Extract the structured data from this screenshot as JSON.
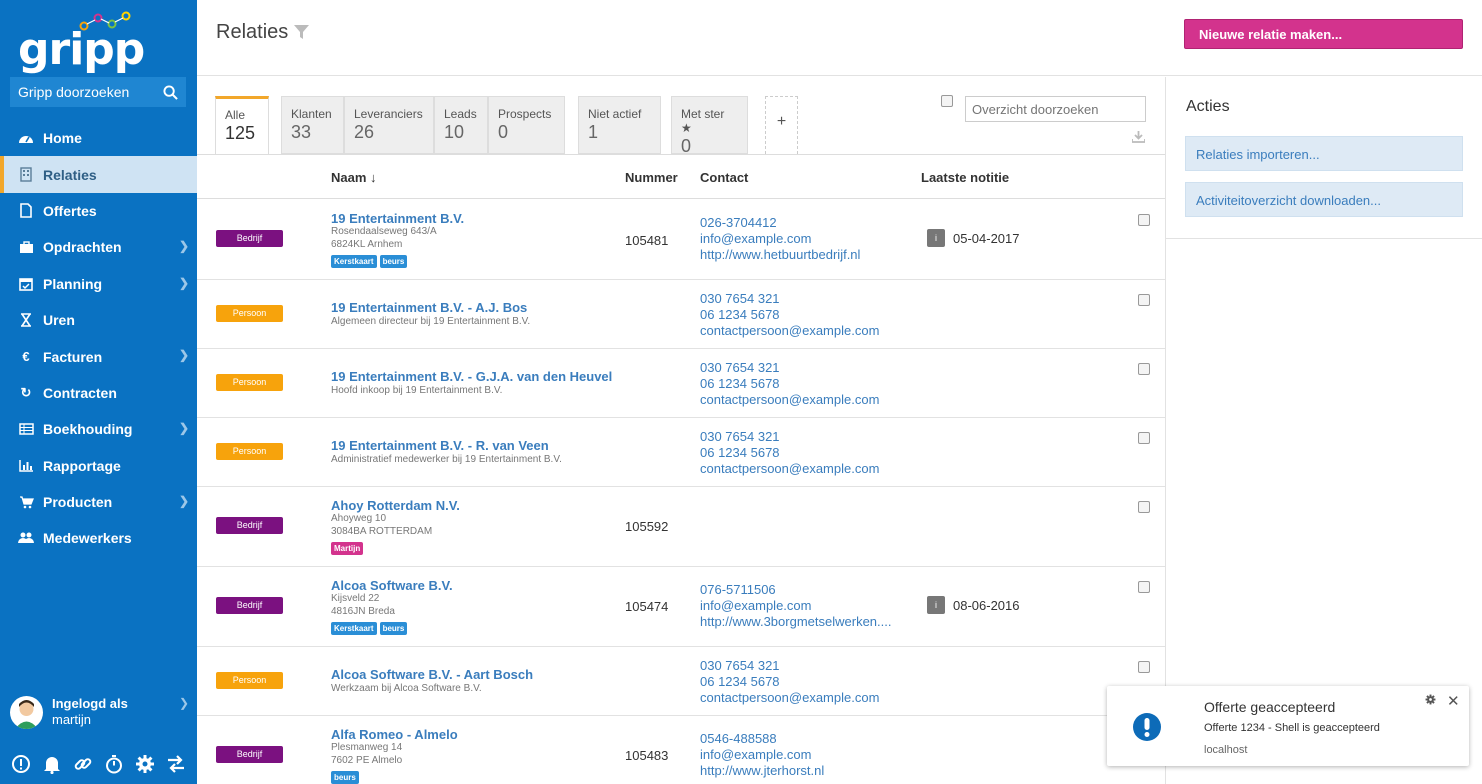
{
  "brand": {
    "logo_text": "gripp",
    "accent": "#0a72c2",
    "active_bar": "#f2a72a"
  },
  "sidebar": {
    "search_label": "Gripp doorzoeken",
    "items": [
      {
        "label": "Home",
        "icon": "dashboard-icon"
      },
      {
        "label": "Relaties",
        "icon": "building-icon"
      },
      {
        "label": "Offertes",
        "icon": "document-icon"
      },
      {
        "label": "Opdrachten",
        "icon": "briefcase-icon"
      },
      {
        "label": "Planning",
        "icon": "calendar-icon"
      },
      {
        "label": "Uren",
        "icon": "hourglass-icon"
      },
      {
        "label": "Facturen",
        "icon": "euro-icon"
      },
      {
        "label": "Contracten",
        "icon": "refresh-icon"
      },
      {
        "label": "Boekhouding",
        "icon": "ledger-icon"
      },
      {
        "label": "Rapportage",
        "icon": "bar-chart-icon"
      },
      {
        "label": "Producten",
        "icon": "cart-icon"
      },
      {
        "label": "Medewerkers",
        "icon": "users-icon"
      }
    ],
    "user": {
      "logged_in_label": "Ingelogd als",
      "name": "martijn"
    }
  },
  "header": {
    "title": "Relaties",
    "new_button": "Nieuwe relatie maken..."
  },
  "tabs": [
    {
      "label": "Alle",
      "count": "125"
    },
    {
      "label": "Klanten",
      "count": "33"
    },
    {
      "label": "Leveranciers",
      "count": "26"
    },
    {
      "label": "Leads",
      "count": "10"
    },
    {
      "label": "Prospects",
      "count": "0"
    },
    {
      "label": "Niet actief",
      "count": "1"
    },
    {
      "label": "Met ster ★",
      "count": "0"
    },
    {
      "label": "+"
    }
  ],
  "overview_search_placeholder": "Overzicht doorzoeken",
  "table": {
    "headers": {
      "name": "Naam ↓",
      "number": "Nummer",
      "contact": "Contact",
      "last_note": "Laatste notitie"
    },
    "rows": [
      {
        "type": "Bedrijf",
        "name": "19 Entertainment B.V.",
        "sub": [
          "Rosendaalseweg 643/A",
          "6824KL Arnhem"
        ],
        "tags": [
          "Kerstkaart",
          "beurs"
        ],
        "number": "105481",
        "contact": [
          "026-3704412",
          "info@example.com",
          "http://www.hetbuurtbedrijf.nl"
        ],
        "note": {
          "icon": "i",
          "date": "05-04-2017"
        }
      },
      {
        "type": "Persoon",
        "name": "19 Entertainment B.V. - A.J. Bos",
        "sub": [
          "Algemeen directeur bij 19 Entertainment B.V."
        ],
        "tags": [],
        "number": "",
        "contact": [
          "030 7654 321",
          "06 1234 5678",
          "contactpersoon@example.com"
        ]
      },
      {
        "type": "Persoon",
        "name": "19 Entertainment B.V. - G.J.A. van den Heuvel",
        "sub": [
          "Hoofd inkoop bij 19 Entertainment B.V."
        ],
        "tags": [],
        "number": "",
        "contact": [
          "030 7654 321",
          "06 1234 5678",
          "contactpersoon@example.com"
        ]
      },
      {
        "type": "Persoon",
        "name": "19 Entertainment B.V. - R. van Veen",
        "sub": [
          "Administratief medewerker bij 19 Entertainment B.V."
        ],
        "tags": [],
        "number": "",
        "contact": [
          "030 7654 321",
          "06 1234 5678",
          "contactpersoon@example.com"
        ]
      },
      {
        "type": "Bedrijf",
        "name": "Ahoy Rotterdam N.V.",
        "sub": [
          "Ahoyweg 10",
          "3084BA ROTTERDAM"
        ],
        "tags": [
          "Martijn"
        ],
        "number": "105592",
        "contact": []
      },
      {
        "type": "Bedrijf",
        "name": "Alcoa Software B.V.",
        "sub": [
          "Kijsveld 22",
          "4816JN Breda"
        ],
        "tags": [
          "Kerstkaart",
          "beurs"
        ],
        "number": "105474",
        "contact": [
          "076-5711506",
          "info@example.com",
          "http://www.3borgmetselwerken...."
        ],
        "note": {
          "icon": "i",
          "date": "08-06-2016"
        }
      },
      {
        "type": "Persoon",
        "name": "Alcoa Software B.V. - Aart Bosch",
        "sub": [
          "Werkzaam bij Alcoa Software B.V."
        ],
        "tags": [],
        "number": "",
        "contact": [
          "030 7654 321",
          "06 1234 5678",
          "contactpersoon@example.com"
        ]
      },
      {
        "type": "Bedrijf",
        "name": "Alfa Romeo - Almelo",
        "sub": [
          "Plesmanweg 14",
          "7602 PE Almelo"
        ],
        "tags": [
          "beurs"
        ],
        "number": "105483",
        "contact": [
          "0546-488588",
          "info@example.com",
          "http://www.jterhorst.nl"
        ]
      }
    ]
  },
  "actions": {
    "title": "Acties",
    "buttons": [
      "Relaties importeren...",
      "Activiteitoverzicht downloaden..."
    ]
  },
  "toast": {
    "title": "Offerte geaccepteerd",
    "message": "Offerte 1234 - Shell is geaccepteerd",
    "host": "localhost",
    "close": "✕"
  }
}
